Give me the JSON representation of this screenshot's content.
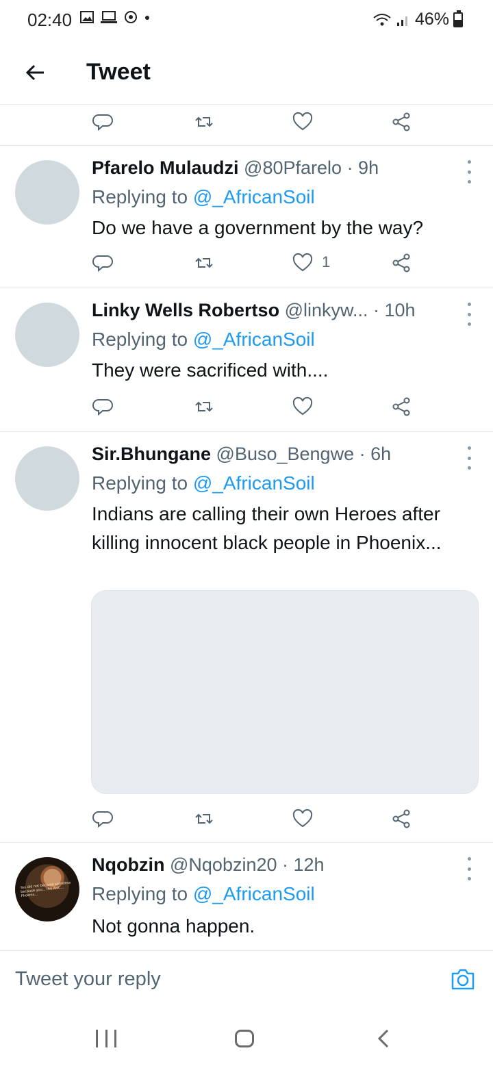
{
  "status": {
    "time": "02:40",
    "battery": "46%"
  },
  "header": {
    "title": "Tweet"
  },
  "tweets": [
    {
      "name": "Pfarelo Mulaudzi",
      "handle": "@80Pfarelo",
      "time": "· 9h",
      "replying_prefix": "Replying to",
      "replying_handle": "@_AfricanSoil",
      "text": "Do we have a government by the way?",
      "likes": "1"
    },
    {
      "name": "Linky Wells Robertso",
      "handle": "@linkyw...",
      "time": "· 10h",
      "replying_prefix": "Replying to",
      "replying_handle": "@_AfricanSoil",
      "text": "They were sacrificed with...."
    },
    {
      "name": "Sir.Bhungane",
      "handle": "@Buso_Bengwe",
      "time": "· 6h",
      "replying_prefix": "Replying to",
      "replying_handle": "@_AfricanSoil",
      "text": "Indians are calling their own Heroes after killing innocent black people in Phoenix..."
    },
    {
      "name": "Nqobzin",
      "handle": "@Nqobzin20",
      "time": "· 12h",
      "replying_prefix": "Replying to",
      "replying_handle": "@_AfricanSoil",
      "text": "Not gonna happen.",
      "avatar_caption": "You did not become spineless because you... the ANC... Phoenix..."
    }
  ],
  "composer": {
    "placeholder": "Tweet your reply"
  },
  "icons": {
    "back": "arrow-left-icon",
    "reply": "reply-icon",
    "retweet": "retweet-icon",
    "like": "heart-icon",
    "share": "share-icon",
    "more": "more-vertical-icon",
    "camera": "camera-icon"
  },
  "colors": {
    "accent": "#1d9bf0",
    "secondary_text": "#536471",
    "avatar_placeholder": "#cfd9de"
  }
}
